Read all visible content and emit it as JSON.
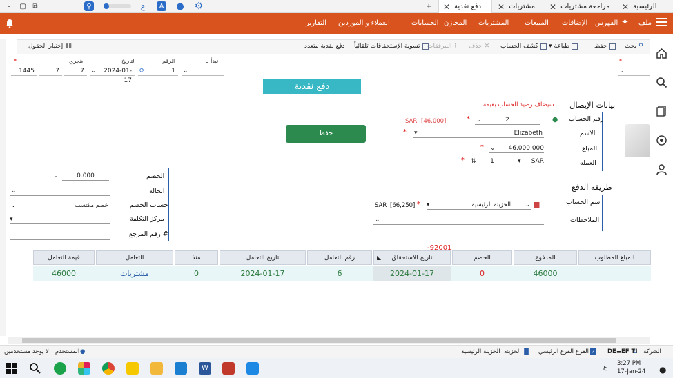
{
  "tabs": [
    {
      "label": "الرئيسية",
      "active": false
    },
    {
      "label": "مراجعة مشتريات",
      "active": false
    },
    {
      "label": "مشتريات",
      "active": false
    },
    {
      "label": "دفع نقدية",
      "active": true
    }
  ],
  "menu": {
    "file": "ملف",
    "index": "الفهرس",
    "items": [
      "الإضافات",
      "المبيعات",
      "المشتريات",
      "المخازن",
      "الحسابات",
      "العملاء و الموردين",
      "التقارير"
    ]
  },
  "toolbar": {
    "search": "بحث",
    "save": "حفظ",
    "print": "طباعة",
    "account_statement": "كشف الحساب",
    "delete": "حذف",
    "attachments": "المرفقات",
    "settle_auto": "تسوية الإستحقاقات تلقائياً",
    "multi_pay": "دفع نقدية متعدد",
    "field_choice": "إختيار الحقول"
  },
  "header": {
    "starts_with_label": "تبدأ بـ",
    "number_label": "الرقم",
    "number_value": "1",
    "date_label": "التاريخ",
    "date_value": "2024-01-17",
    "hijri_label": "هجري",
    "hijri_day": "7",
    "hijri_month": "7",
    "hijri_year": "1445"
  },
  "page_title": "دفع نقدية",
  "receipt": {
    "section_title": "بيانات الإيصال",
    "warning": "سيضاف رصيد للحساب بقيمة",
    "account_number_label": "رقم الحساب",
    "account_number": "2",
    "account_balance": "[46,000]",
    "balance_currency": "SAR",
    "name_label": "الاسم",
    "name": "Elizabeth",
    "amount_label": "المبلغ",
    "amount": "46,000.000",
    "currency_label": "العمله",
    "currency": "SAR",
    "rate": "1"
  },
  "save_button": "حفظ",
  "discount": {
    "discount_label": "الخصم",
    "discount_value": "0.000",
    "status_label": "الحالة",
    "discount_account_label": "حساب الخصم",
    "discount_account": "خصم مكتسب",
    "cost_center_label": "مركز التكلفة",
    "reference_label": "رقم المرجع #"
  },
  "payment": {
    "section_title": "طريقة الدفع",
    "account_name_label": "اسم الحساب",
    "account_name": "الخزينة الرئيسية",
    "cash_balance": "[66,250]",
    "cash_currency": "SAR",
    "notes_label": "الملاحظات"
  },
  "table": {
    "floating_value": "-92001",
    "headers": [
      "المبلغ المطلوب",
      "المدفوع",
      "الخصم",
      "تاريخ الاستحقاق",
      "رقم التعامل",
      "تاريخ التعامل",
      "منذ",
      "التعامل",
      "قيمة التعامل"
    ],
    "row": {
      "paid": "46000",
      "discount": "0",
      "due_date": "2024-01-17",
      "txn_no": "6",
      "txn_date": "2024-01-17",
      "since": "0",
      "txn": "مشتريات",
      "txn_value": "46000"
    }
  },
  "status": {
    "company_label": "الشركة",
    "company": "DE≡EF TI",
    "branch_label": "الفرع",
    "main_branch": "الفرع الرئيسي",
    "treasury_label": "الخزينه",
    "main_treasury": "الخزينة الرئيسية",
    "user_label": "المستخدم",
    "no_user": "لا يوجد مستخدمين"
  },
  "clock": {
    "time": "3:27 PM",
    "date": "17-Jan-24"
  },
  "colors": {
    "accent": "#d9531e",
    "teal": "#37b8c4",
    "green": "#2c8a4e",
    "blue": "#2a5ea8"
  }
}
